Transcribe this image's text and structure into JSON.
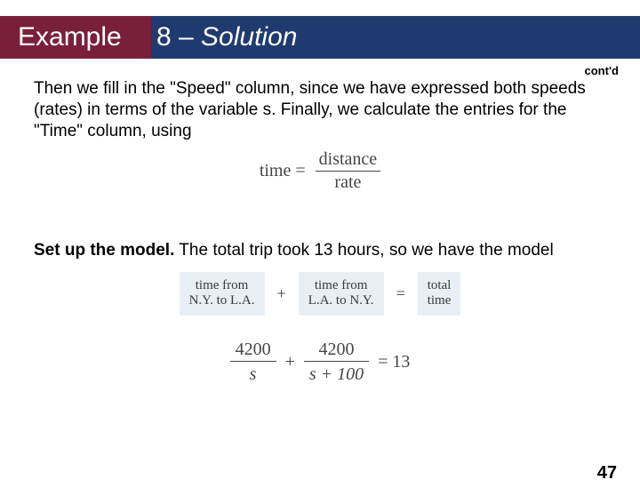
{
  "title": {
    "accent": "Example",
    "rest_num": "8 – ",
    "rest_italic": "Solution",
    "contd": "cont'd"
  },
  "paragraph1": "Then we fill in the \"Speed\" column, since we have expressed both speeds (rates) in terms of the variable s. Finally, we calculate the entries for the \"Time\" column, using",
  "formula1": {
    "lhs": "time =",
    "top": "distance",
    "bot": "rate"
  },
  "paragraph2_bold": "Set up the model.",
  "paragraph2_rest": " The total trip took 13 hours, so we have the model",
  "boxrow": {
    "box1_l1": "time from",
    "box1_l2": "N.Y. to L.A.",
    "plus": "+",
    "box2_l1": "time from",
    "box2_l2": "L.A. to N.Y.",
    "eq": "=",
    "box3_l1": "total",
    "box3_l2": "time"
  },
  "formula2": {
    "f1_top": "4200",
    "f1_bot": "s",
    "plus": "+",
    "f2_top": "4200",
    "f2_bot": "s + 100",
    "eq": "= 13"
  },
  "pagenum": "47"
}
